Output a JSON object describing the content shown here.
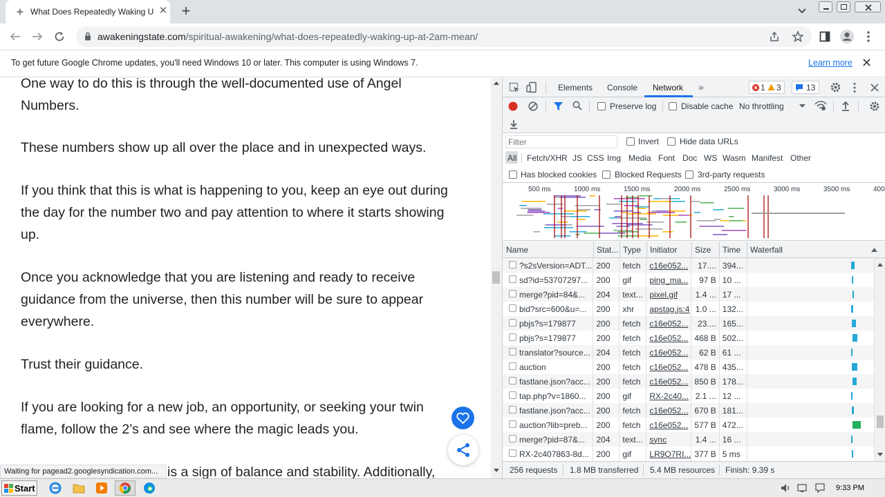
{
  "browser": {
    "tab_title": "What Does Repeatedly Waking Up a",
    "tab_close": "✕",
    "new_tab": "+",
    "url_domain": "awakeningstate.com",
    "url_path": "/spiritual-awakening/what-does-repeatedly-waking-up-at-2am-mean/"
  },
  "infobar": {
    "message": "To get future Google Chrome updates, you'll need Windows 10 or later. This computer is using Windows 7.",
    "learn_more": "Learn more",
    "close": "✕"
  },
  "article": {
    "p1": "One way to do this is through the well-documented use of Angel Numbers.",
    "p2": "These numbers show up all over the place and in unexpected ways.",
    "p3": "If you think that this is what is happening to you, keep an eye out during the day for the number two and pay attention to where it starts showing up.",
    "p4": "Once you acknowledge that you are listening and ready to receive guidance from the universe, then this number will be sure to appear everywhere.",
    "p5": "Trust their guidance.",
    "p6": "If you are looking for a new job, an opportunity, or seeking your twin flame, follow the 2’s and see where the magic leads you.",
    "p7": "is a sign of balance and stability. Additionally,"
  },
  "status_bubble": "Waiting for pagead2.googlesyndication.com...",
  "devtools": {
    "tabs": [
      "Elements",
      "Console",
      "Network"
    ],
    "active_tab": "Network",
    "more": "»",
    "errors": "1",
    "warnings": "3",
    "messages": "13",
    "preserve_log": "Preserve log",
    "disable_cache": "Disable cache",
    "throttling": "No throttling",
    "filter_placeholder": "Filter",
    "invert": "Invert",
    "hide_data_urls": "Hide data URLs",
    "type_filters": [
      "All",
      "Fetch/XHR",
      "JS",
      "CSS",
      "Img",
      "Media",
      "Font",
      "Doc",
      "WS",
      "Wasm",
      "Manifest",
      "Other"
    ],
    "has_blocked_cookies": "Has blocked cookies",
    "blocked_requests": "Blocked Requests",
    "third_party": "3rd-party requests",
    "timeline_ticks": [
      "500 ms",
      "1000 ms",
      "1500 ms",
      "2000 ms",
      "2500 ms",
      "3000 ms",
      "3500 ms",
      "400"
    ],
    "columns": [
      "Name",
      "Stat...",
      "Type",
      "Initiator",
      "Size",
      "Time",
      "Waterfall"
    ],
    "requests": [
      {
        "name": "?s2sVersion=ADT...",
        "status": "200",
        "type": "fetch",
        "initiator": "c16e052...",
        "size": "17....",
        "time": "394..."
      },
      {
        "name": "sd?id=53707297...",
        "status": "200",
        "type": "gif",
        "initiator": "ping_ma...",
        "size": "97 B",
        "time": "10 ..."
      },
      {
        "name": "merge?pid=84&...",
        "status": "204",
        "type": "text...",
        "initiator": "pixel.gif",
        "size": "1.4 ...",
        "time": "17 ..."
      },
      {
        "name": "bid?src=600&u=...",
        "status": "200",
        "type": "xhr",
        "initiator": "apstag.js:4",
        "size": "1.0 ...",
        "time": "132..."
      },
      {
        "name": "pbjs?s=179877",
        "status": "200",
        "type": "fetch",
        "initiator": "c16e052...",
        "size": "23....",
        "time": "165..."
      },
      {
        "name": "pbjs?s=179877",
        "status": "200",
        "type": "fetch",
        "initiator": "c16e052...",
        "size": "468 B",
        "time": "502..."
      },
      {
        "name": "translator?source...",
        "status": "204",
        "type": "fetch",
        "initiator": "c16e052...",
        "size": "62 B",
        "time": "61 ..."
      },
      {
        "name": "auction",
        "status": "200",
        "type": "fetch",
        "initiator": "c16e052...",
        "size": "478 B",
        "time": "435..."
      },
      {
        "name": "fastlane.json?acc...",
        "status": "200",
        "type": "fetch",
        "initiator": "c16e052...",
        "size": "850 B",
        "time": "178..."
      },
      {
        "name": "tap.php?v=1860...",
        "status": "200",
        "type": "gif",
        "initiator": "RX-2c40...",
        "size": "2.1 ...",
        "time": "12 ..."
      },
      {
        "name": "fastlane.json?acc...",
        "status": "200",
        "type": "fetch",
        "initiator": "c16e052...",
        "size": "670 B",
        "time": "181..."
      },
      {
        "name": "auction?lib=preb...",
        "status": "200",
        "type": "fetch",
        "initiator": "c16e052...",
        "size": "577 B",
        "time": "472..."
      },
      {
        "name": "merge?pid=87&...",
        "status": "204",
        "type": "text...",
        "initiator": "sync",
        "size": "1.4 ...",
        "time": "16 ..."
      },
      {
        "name": "RX-2c407863-8d...",
        "status": "200",
        "type": "gif",
        "initiator": "LR9Q7RI...",
        "size": "377 B",
        "time": "5 ms"
      }
    ],
    "summary": {
      "requests": "256 requests",
      "transferred": "1.8 MB transferred",
      "resources": "5.4 MB resources",
      "finish": "Finish: 9.39 s"
    }
  },
  "taskbar": {
    "start": "Start",
    "clock": "9:33 PM"
  }
}
